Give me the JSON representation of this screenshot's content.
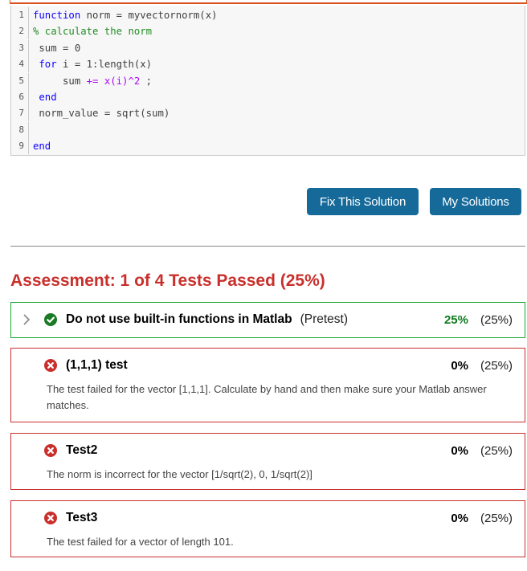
{
  "code_editor": {
    "lines": [
      {
        "num": "1",
        "segments": [
          {
            "t": "function",
            "c": "kw"
          },
          {
            "t": " norm = myvectornorm(x)",
            "c": ""
          }
        ]
      },
      {
        "num": "2",
        "segments": [
          {
            "t": "% calculate the norm",
            "c": "cm"
          }
        ]
      },
      {
        "num": "3",
        "segments": [
          {
            "t": " sum = 0",
            "c": ""
          }
        ]
      },
      {
        "num": "4",
        "segments": [
          {
            "t": " ",
            "c": ""
          },
          {
            "t": "for",
            "c": "kw"
          },
          {
            "t": " i = 1:length(x)",
            "c": ""
          }
        ]
      },
      {
        "num": "5",
        "segments": [
          {
            "t": "     sum ",
            "c": ""
          },
          {
            "t": "+= x(i)^2",
            "c": "op"
          },
          {
            "t": " ;",
            "c": ""
          }
        ]
      },
      {
        "num": "6",
        "segments": [
          {
            "t": " ",
            "c": ""
          },
          {
            "t": "end",
            "c": "kw"
          }
        ]
      },
      {
        "num": "7",
        "segments": [
          {
            "t": " norm_value = sqrt(sum)",
            "c": ""
          }
        ]
      },
      {
        "num": "8",
        "segments": []
      },
      {
        "num": "9",
        "segments": [
          {
            "t": "end",
            "c": "kw"
          }
        ]
      }
    ]
  },
  "actions": {
    "fix_label": "Fix This Solution",
    "my_solutions_label": "My Solutions"
  },
  "assessment": {
    "title": "Assessment: 1 of 4 Tests Passed (25%)",
    "tests": [
      {
        "name": "Do not use built-in functions in Matlab",
        "tag": "(Pretest)",
        "status": "passed",
        "score": "25%",
        "weight": "(25%)",
        "description": ""
      },
      {
        "name": "(1,1,1) test",
        "tag": "",
        "status": "failed",
        "score": "0%",
        "weight": "(25%)",
        "description": "The test failed for the vector [1,1,1]. Calculate by hand and then make sure your Matlab answer matches."
      },
      {
        "name": "Test2",
        "tag": "",
        "status": "failed",
        "score": "0%",
        "weight": "(25%)",
        "description": "The norm is incorrect for the vector [1/sqrt(2), 0, 1/sqrt(2)]"
      },
      {
        "name": "Test3",
        "tag": "",
        "status": "failed",
        "score": "0%",
        "weight": "(25%)",
        "description": "The test failed for a vector of length 101."
      }
    ]
  },
  "colors": {
    "accent_button": "#156a9a",
    "fail": "#c9302c",
    "pass": "#1aa632",
    "pass_text": "#0f7a1f",
    "highlight_border": "#d9531e"
  }
}
